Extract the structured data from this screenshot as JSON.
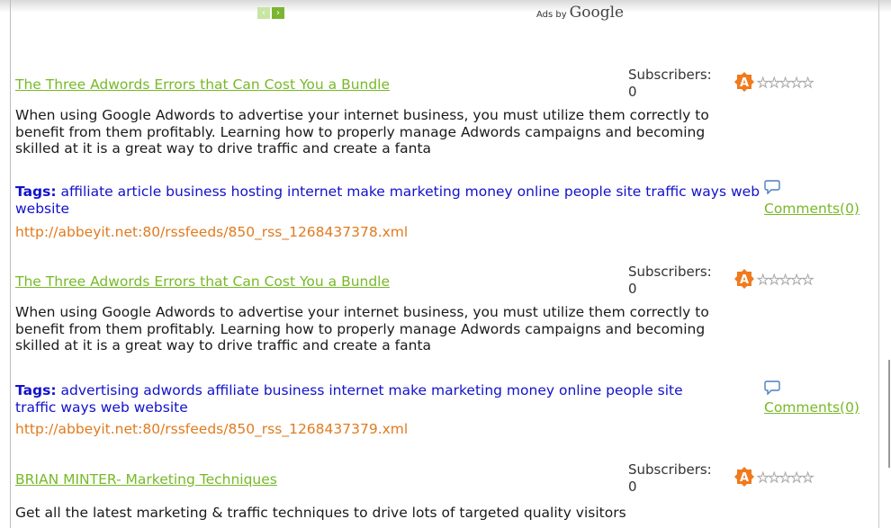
{
  "ads": {
    "prev_glyph": "‹",
    "next_glyph": "›",
    "ads_by": "Ads by",
    "brand": "Google"
  },
  "feeds": [
    {
      "title": "The Three Adwords Errors that Can Cost You a Bundle",
      "subscribers_label": "Subscribers:",
      "subscribers_count": "0",
      "badge_letter": "A",
      "rating": 0,
      "description": "When using Google Adwords to advertise your internet business, you must utilize them correctly to benefit from them profitably. Learning how to properly manage Adwords campaigns and becoming skilled at it is a great way to drive traffic and create a fanta",
      "tags_label": "Tags:",
      "tags": "affiliate article business hosting internet make marketing money online people site traffic ways web website",
      "comments": "Comments(0)",
      "url": "http://abbeyit.net:80/rssfeeds/850_rss_1268437378.xml"
    },
    {
      "title": "The Three Adwords Errors that Can Cost You a Bundle",
      "subscribers_label": "Subscribers:",
      "subscribers_count": "0",
      "badge_letter": "A",
      "rating": 0,
      "description": "When using Google Adwords to advertise your internet business, you must utilize them correctly to benefit from them profitably. Learning how to properly manage Adwords campaigns and becoming skilled at it is a great way to drive traffic and create a fanta",
      "tags_label": "Tags:",
      "tags": "advertising adwords affiliate business internet make marketing money online people site traffic ways web website",
      "comments": "Comments(0)",
      "url": "http://abbeyit.net:80/rssfeeds/850_rss_1268437379.xml"
    },
    {
      "title": "BRIAN MINTER- Marketing Techniques",
      "subscribers_label": "Subscribers:",
      "subscribers_count": "0",
      "badge_letter": "A",
      "rating": 0,
      "description": "Get all the latest marketing & traffic techniques to drive lots of targeted quality visitors"
    }
  ],
  "colors": {
    "title_link": "#78b928",
    "tags": "#1111cc",
    "url": "#e07b1f",
    "badge": "#f07a1c"
  }
}
